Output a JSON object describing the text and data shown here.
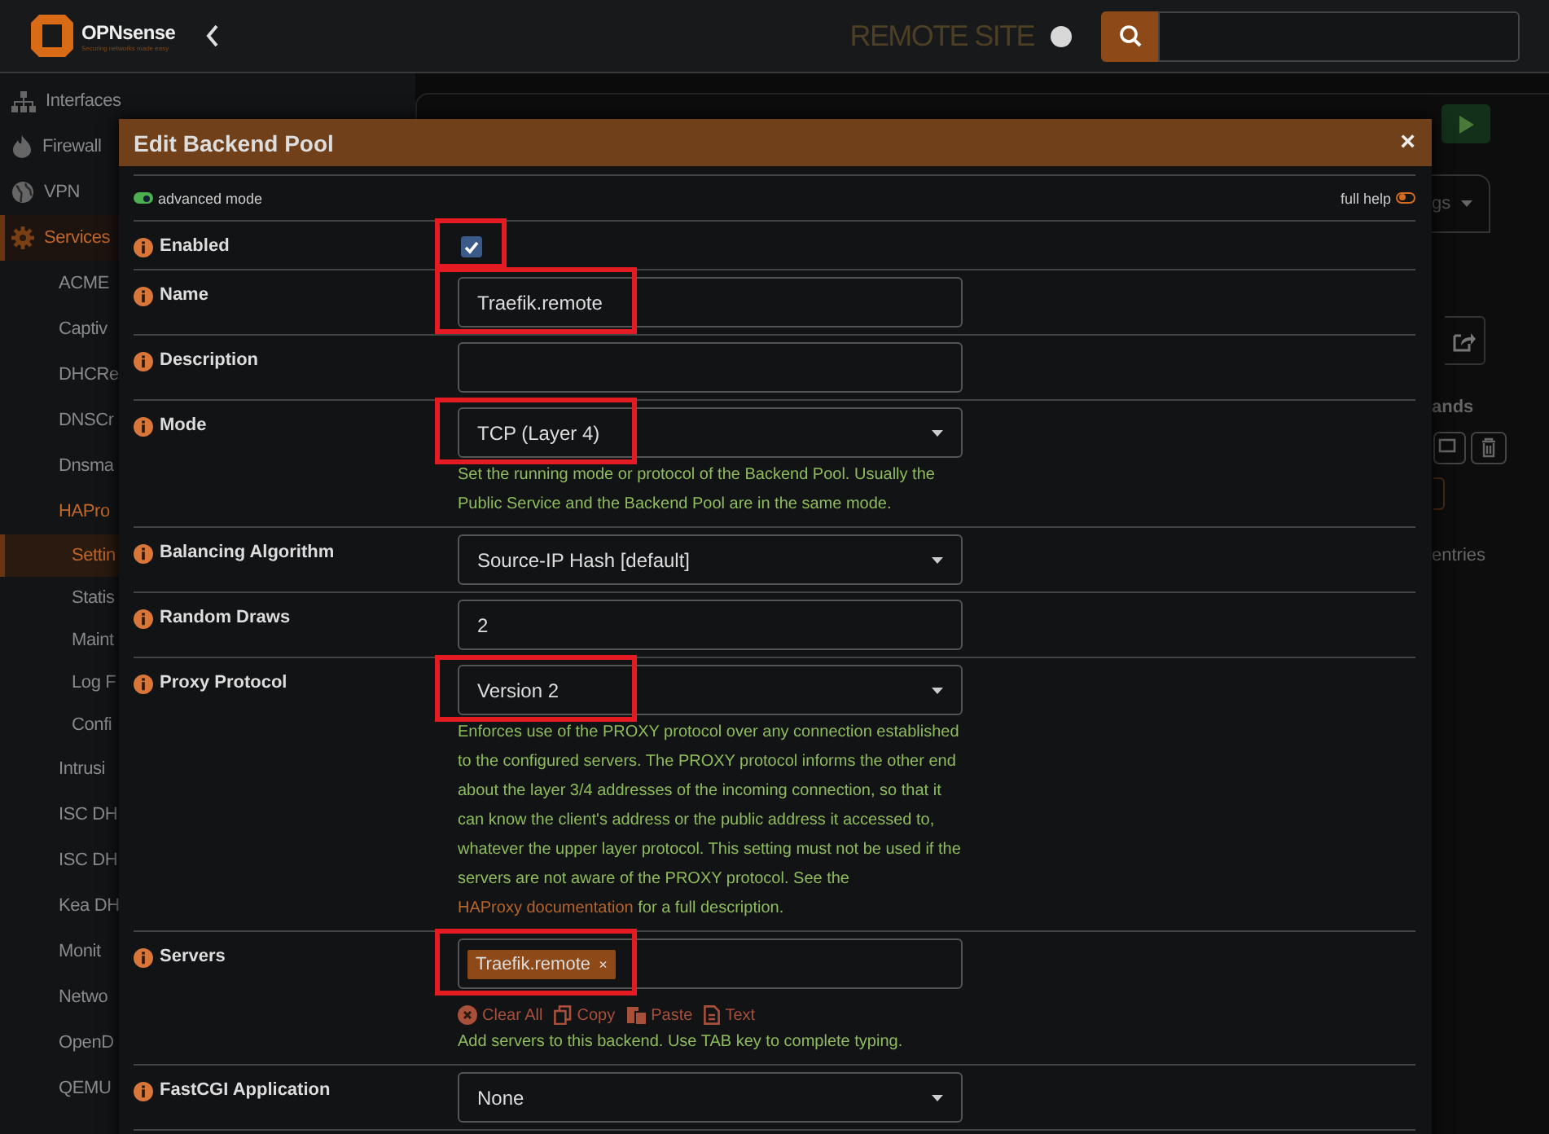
{
  "topbar": {
    "brand": "OPNsense",
    "tagline": "Securing networks made easy",
    "site_label": "REMOTE SITE"
  },
  "sidebar": {
    "items": [
      {
        "label": "Interfaces",
        "active": false
      },
      {
        "label": "Firewall",
        "active": false
      },
      {
        "label": "VPN",
        "active": false
      },
      {
        "label": "Services",
        "active": true,
        "children": [
          {
            "label": "ACME",
            "active": false
          },
          {
            "label": "Captiv",
            "active": false
          },
          {
            "label": "DHCRe",
            "active": false
          },
          {
            "label": "DNSCr",
            "active": false
          },
          {
            "label": "Dnsma",
            "active": false
          },
          {
            "label": "HAPro",
            "active": true,
            "children": [
              {
                "label": "Settin",
                "active": true
              },
              {
                "label": "Statis",
                "active": false
              },
              {
                "label": "Maint",
                "active": false
              },
              {
                "label": "Log F",
                "active": false
              },
              {
                "label": "Confi",
                "active": false
              }
            ]
          },
          {
            "label": "Intrusi",
            "active": false
          },
          {
            "label": "ISC DH",
            "active": false
          },
          {
            "label": "ISC DH",
            "active": false
          },
          {
            "label": "Kea DH",
            "active": false
          },
          {
            "label": "Monit",
            "active": false
          },
          {
            "label": "Netwo",
            "active": false
          },
          {
            "label": "OpenD",
            "active": false
          },
          {
            "label": "QEMU",
            "active": false
          }
        ]
      }
    ]
  },
  "background_panel": {
    "dropdown_fragment": "gs",
    "column_fragment": "ands",
    "footer_fragment": "entries"
  },
  "modal": {
    "title": "Edit Backend Pool",
    "close": "×",
    "advanced_mode": {
      "label": "advanced mode",
      "on": true
    },
    "full_help": {
      "label": "full help",
      "on": false
    },
    "fields": [
      {
        "kind": "checkbox",
        "label": "Enabled",
        "checked": true,
        "highlighted": true
      },
      {
        "kind": "text",
        "label": "Name",
        "value": "Traefik.remote",
        "highlighted": true
      },
      {
        "kind": "text",
        "label": "Description",
        "highlighted": false
      },
      {
        "kind": "select",
        "label": "Mode",
        "value": "TCP (Layer 4)",
        "help": "Set the running mode or protocol of the Backend Pool. Usually the Public Service and the Backend Pool are in the same mode.",
        "highlighted": true
      },
      {
        "kind": "select",
        "label": "Balancing Algorithm",
        "value": "Source-IP Hash [default]",
        "highlighted": false
      },
      {
        "kind": "text",
        "label": "Random Draws",
        "value": "2",
        "highlighted": false
      },
      {
        "kind": "select",
        "label": "Proxy Protocol",
        "value": "Version 2",
        "help": "Enforces use of the PROXY protocol over any connection established to the configured servers. The PROXY protocol informs the other end about the layer 3/4 addresses of the incoming connection, so that it can know the client's address or the public address it accessed to, whatever the upper layer protocol. This setting must not be used if the servers are not aware of the PROXY protocol. See the ",
        "help_link": "HAProxy documentation",
        "help_after": " for a full description.",
        "highlighted": true
      },
      {
        "kind": "tokens",
        "label": "Servers",
        "tokens": [
          {
            "text": "Traefik.remote",
            "remove": "×"
          }
        ],
        "actions": [
          "Clear All",
          "Copy",
          "Paste",
          "Text"
        ],
        "help": "Add servers to this backend. Use TAB key to complete typing.",
        "highlighted": true
      },
      {
        "kind": "select",
        "label": "FastCGI Application",
        "value": "None",
        "highlighted": false
      }
    ]
  }
}
